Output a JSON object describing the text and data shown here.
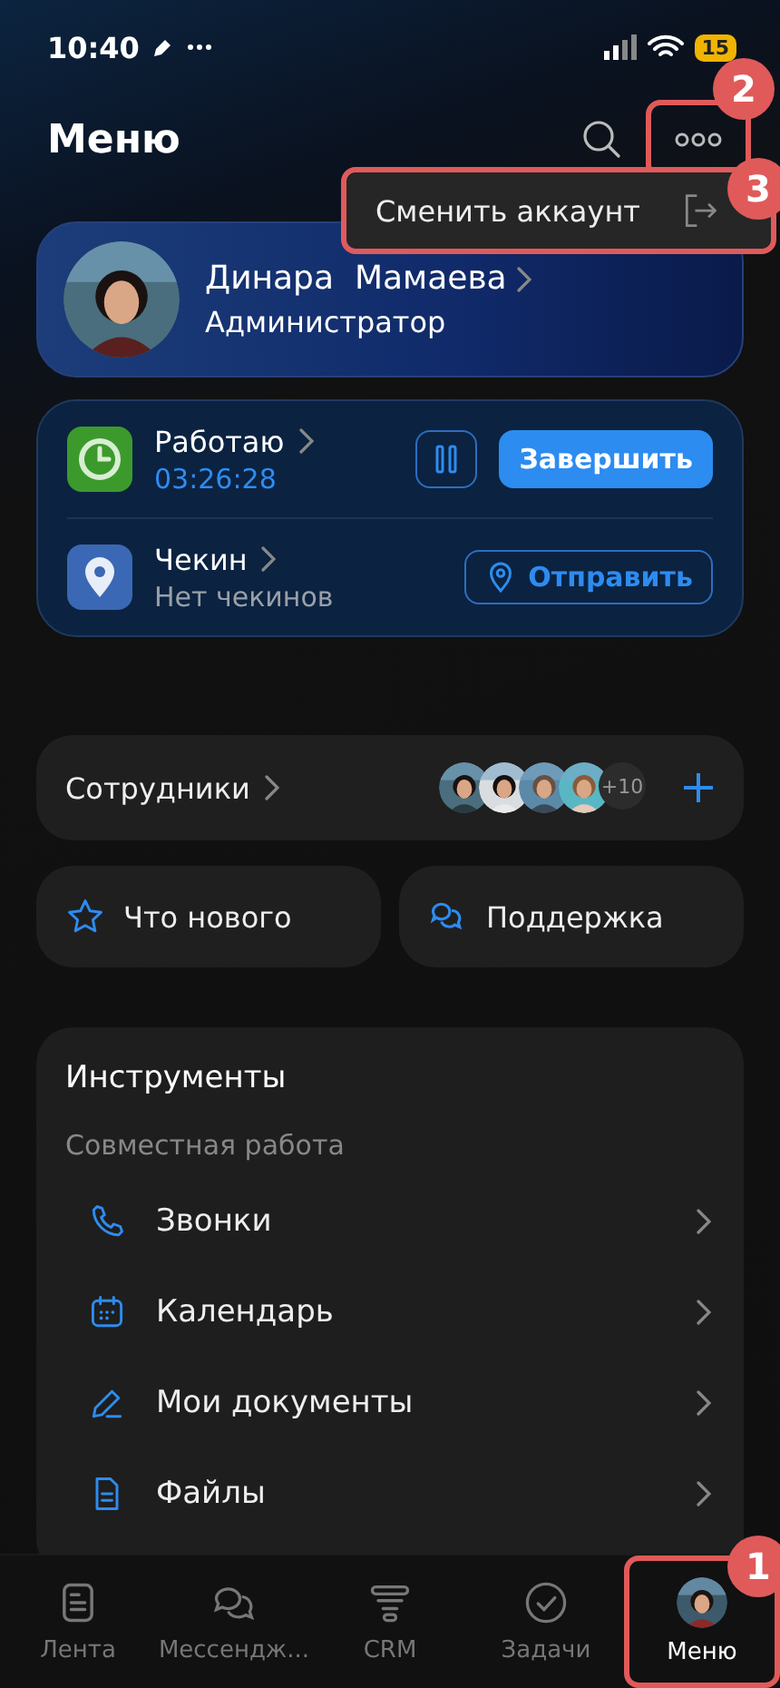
{
  "status_bar": {
    "time": "10:40",
    "battery": "15"
  },
  "header": {
    "title": "Меню"
  },
  "popup_menu": {
    "items": [
      {
        "label": "Сменить аккаунт"
      }
    ]
  },
  "profile": {
    "name": "Динара  Мамаева",
    "role": "Администратор"
  },
  "work": {
    "status": "Работаю",
    "timer": "03:26:28",
    "finish_button": "Завершить",
    "checkin": "Чекин",
    "checkin_status": "Нет чекинов",
    "send_button": "Отправить"
  },
  "employees": {
    "label": "Сотрудники",
    "more": "+10"
  },
  "quick_actions": [
    {
      "label": "Что нового"
    },
    {
      "label": "Поддержка"
    }
  ],
  "tools": {
    "title": "Инструменты",
    "section": "Совместная работа",
    "items": [
      {
        "label": "Звонки"
      },
      {
        "label": "Календарь"
      },
      {
        "label": "Мои документы"
      },
      {
        "label": "Файлы"
      }
    ]
  },
  "tab_bar": [
    {
      "label": "Лента",
      "selected": false
    },
    {
      "label": "Мессендж...",
      "selected": false
    },
    {
      "label": "CRM",
      "selected": false
    },
    {
      "label": "Задачи",
      "selected": false
    },
    {
      "label": "Меню",
      "selected": true
    }
  ],
  "callouts": [
    {
      "label": "2"
    },
    {
      "label": "3"
    },
    {
      "label": "1"
    }
  ]
}
